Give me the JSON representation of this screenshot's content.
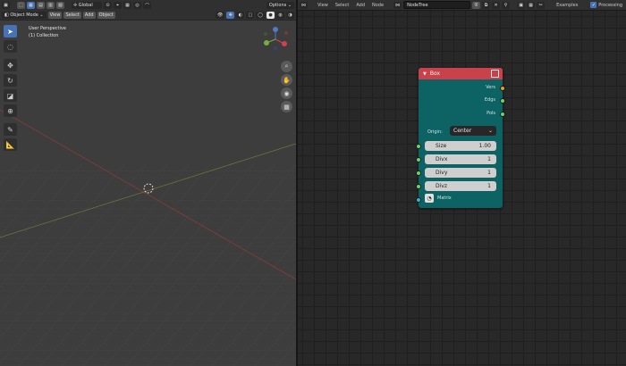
{
  "viewport": {
    "mode": "Object Mode",
    "menus": [
      "View",
      "Select",
      "Add",
      "Object"
    ],
    "transform_orientation": "Global",
    "options_label": "Options",
    "perspective": "User Perspective",
    "collection": "(1) Collection"
  },
  "node_editor": {
    "menus": [
      "View",
      "Select",
      "Add",
      "Node"
    ],
    "tree_name": "NodeTree",
    "examples_label": "Examples",
    "processing_label": "Processing"
  },
  "node": {
    "title": "Box",
    "outputs": [
      "Vers",
      "Edgs",
      "Pols"
    ],
    "origin_label": "Origin:",
    "origin_value": "Center",
    "fields": [
      {
        "label": "Size",
        "value": "1.00"
      },
      {
        "label": "Divx",
        "value": "1"
      },
      {
        "label": "Divy",
        "value": "1"
      },
      {
        "label": "Divz",
        "value": "1"
      }
    ],
    "matrix_label": "Matrix"
  },
  "colors": {
    "node_header": "#c9424b",
    "node_body": "#0d6363",
    "socket_vertices": "#e89a2a",
    "socket_data": "#6bd36b",
    "socket_matrix": "#33b5c5",
    "active_tool": "#4772b3"
  }
}
